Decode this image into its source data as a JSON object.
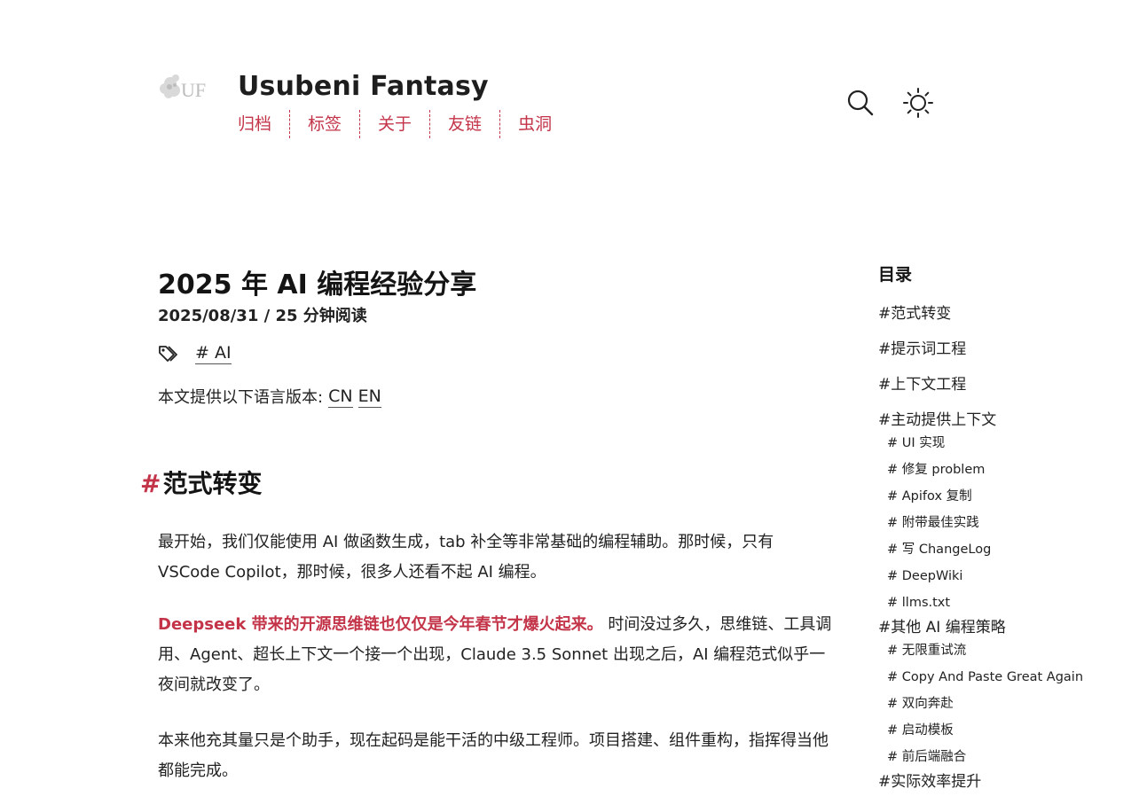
{
  "header": {
    "logo_text": "UF",
    "site_title": "Usubeni Fantasy",
    "nav": [
      "归档",
      "标签",
      "关于",
      "友链",
      "虫洞"
    ],
    "search_icon": "search-icon",
    "theme_icon": "sun-icon"
  },
  "article": {
    "title": "2025 年 AI 编程经验分享",
    "meta": "2025/08/31 / 25 分钟阅读",
    "tag": "# AI",
    "tag_icon": "tags-icon",
    "lang_label": "本文提供以下语言版本:",
    "langs": [
      "CN",
      "EN"
    ],
    "section_hash": "#",
    "section_title": "范式转变",
    "p1": "最开始，我们仅能使用 AI 做函数生成，tab 补全等非常基础的编程辅助。那时候，只有 VSCode Copilot，那时候，很多人还看不起 AI 编程。",
    "p2_em": "Deepseek 带来的开源思维链也仅仅是今年春节才爆火起来。",
    "p2_rest": " 时间没过多久，思维链、工具调用、Agent、超长上下文一个接一个出现，Claude 3.5 Sonnet 出现之后，AI 编程范式似乎一夜间就改变了。",
    "p3": "本来他充其量只是个助手，现在起码是能干活的中级工程师。项目搭建、组件重构，指挥得当他都能完成。"
  },
  "toc": {
    "title": "目录",
    "items": [
      {
        "label": "#范式转变"
      },
      {
        "label": "#提示词工程"
      },
      {
        "label": "#上下文工程"
      },
      {
        "label": "#主动提供上下文",
        "children": [
          "# UI 实现",
          "# 修复 problem",
          "# Apifox 复制",
          "# 附带最佳实践",
          "# 写 ChangeLog",
          "# DeepWiki",
          "# llms.txt"
        ]
      },
      {
        "label": "#其他 AI 编程策略",
        "children": [
          "# 无限重试流",
          "# Copy And Paste Great Again",
          "# 双向奔赴",
          "# 启动模板",
          "# 前后端融合"
        ]
      },
      {
        "label": "#实际效率提升"
      }
    ]
  },
  "colors": {
    "accent": "#c33449",
    "text": "#222222",
    "background": "#ffffff"
  }
}
